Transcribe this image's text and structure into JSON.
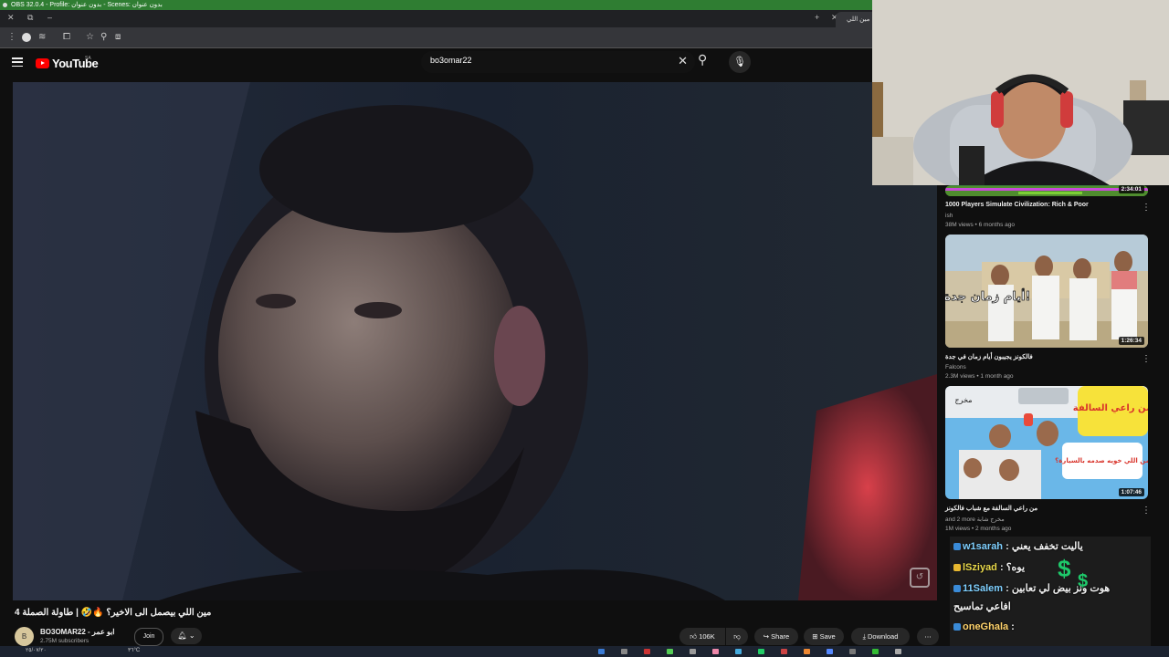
{
  "obs_title": "OBS 32.0.4 - Profile: بدون عنوان - Scenes: بدون عنوان",
  "browser": {
    "active_tab_label": "مين اللي",
    "new_tab": "+"
  },
  "youtube": {
    "logo": "YouTube",
    "region": "SA",
    "search_value": "bo3omar22"
  },
  "video": {
    "title": "مين اللي بيصمل الى الاخير؟ 🔥🤣 | طاولة الصملة 4",
    "channel_avatar": "B",
    "channel_name": "BO3OMAR22 - ابو عمر",
    "subscribers": "2.75M subscribers",
    "join_label": "Join",
    "like_count": "106K",
    "share_label": "Share",
    "save_label": "Save",
    "download_label": "Download"
  },
  "recommendations": [
    {
      "title": "1000 Players Simulate Civilization: Rich & Poor",
      "channel": "ish",
      "meta": "38M views • 6 months ago",
      "duration": "2:34:01"
    },
    {
      "title": "فالكونز يجيبون أيام زمان في جدة",
      "channel": "Falcons",
      "meta": "2.3M views • 1 month ago",
      "duration": "1:26:34",
      "thumb_text": "أيام زمان جدة!"
    },
    {
      "title": "من راعي السالفة مع شباب فالكونز",
      "channel": "and 2 more مخرج شابة",
      "meta": "1M views • 2 months ago",
      "duration": "1:07:46",
      "thumb_text_1": "من راعي السالفة",
      "thumb_text_2": "من اللي خويه صدمه بالسيارة؟",
      "thumb_text_3": "مخرج"
    }
  ],
  "chat": [
    {
      "user": "w1sarah",
      "text": "ياليت تخفف يعني",
      "color": "#7fd0ff"
    },
    {
      "user": "lSziyad",
      "text": "يوه؟",
      "color": "#e8d84a"
    },
    {
      "user": "11Salem",
      "text": "هوت ونز بيض لي تعابين",
      "color": "#7fd0ff"
    },
    {
      "user": "",
      "text": "افاعي تماسيح",
      "color": "#ffffff"
    },
    {
      "user": "oneGhala",
      "text": "",
      "color": "#ffd36b"
    }
  ],
  "taskbar": {
    "date": "٢٥/٠٧/٢٠",
    "temp": "٣٦°C"
  },
  "colors": {
    "obs_bar": "#2f7d32",
    "yt_red": "#ff0000",
    "bg": "#0f0f0f"
  }
}
